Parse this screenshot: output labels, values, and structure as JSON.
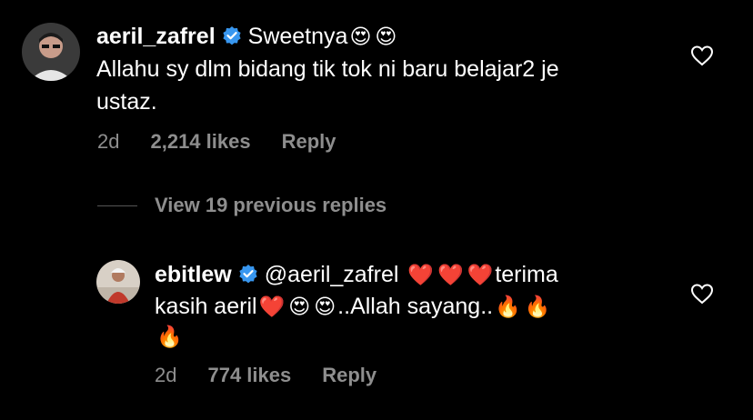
{
  "comment": {
    "username": "aeril_zafrel",
    "text_line1": "Sweetnya",
    "text_line2": "Allahu sy dlm bidang tik tok ni baru belajar2 je",
    "text_line3": "ustaz.",
    "emojis_line1": [
      "😍",
      "😍"
    ],
    "time": "2d",
    "likes": "2,214 likes",
    "reply_label": "Reply"
  },
  "view_replies": "View 19 previous replies",
  "reply": {
    "username": "ebitlew",
    "mention": "@aeril_zafrel",
    "hearts": [
      "❤️",
      "❤️",
      "❤️"
    ],
    "text_a": "terima",
    "text_b": "kasih aeril",
    "text_c": "..Allah sayang..",
    "emojis_b1": [
      "❤️",
      "😍",
      "😍"
    ],
    "emojis_b2": [
      "🔥",
      "🔥"
    ],
    "emojis_c": [
      "🔥"
    ],
    "time": "2d",
    "likes": "774 likes",
    "reply_label": "Reply"
  },
  "colors": {
    "background": "#000000",
    "text": "#ffffff",
    "muted": "#8e8e8e",
    "verified": "#3897f0"
  },
  "icons": [
    "verified-badge-icon",
    "heart-outline-icon"
  ]
}
